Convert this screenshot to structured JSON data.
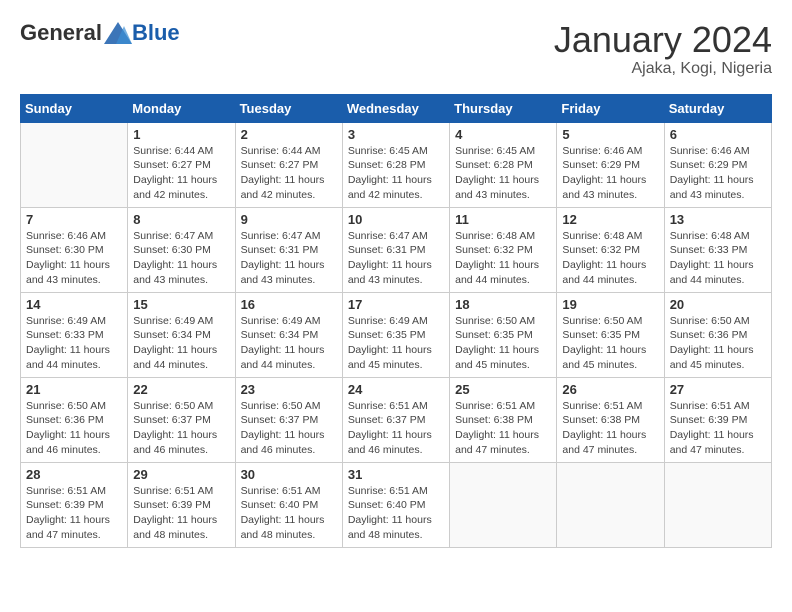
{
  "header": {
    "logo_general": "General",
    "logo_blue": "Blue",
    "month_title": "January 2024",
    "location": "Ajaka, Kogi, Nigeria"
  },
  "weekdays": [
    "Sunday",
    "Monday",
    "Tuesday",
    "Wednesday",
    "Thursday",
    "Friday",
    "Saturday"
  ],
  "weeks": [
    [
      {
        "day": "",
        "info": ""
      },
      {
        "day": "1",
        "info": "Sunrise: 6:44 AM\nSunset: 6:27 PM\nDaylight: 11 hours and 42 minutes."
      },
      {
        "day": "2",
        "info": "Sunrise: 6:44 AM\nSunset: 6:27 PM\nDaylight: 11 hours and 42 minutes."
      },
      {
        "day": "3",
        "info": "Sunrise: 6:45 AM\nSunset: 6:28 PM\nDaylight: 11 hours and 42 minutes."
      },
      {
        "day": "4",
        "info": "Sunrise: 6:45 AM\nSunset: 6:28 PM\nDaylight: 11 hours and 43 minutes."
      },
      {
        "day": "5",
        "info": "Sunrise: 6:46 AM\nSunset: 6:29 PM\nDaylight: 11 hours and 43 minutes."
      },
      {
        "day": "6",
        "info": "Sunrise: 6:46 AM\nSunset: 6:29 PM\nDaylight: 11 hours and 43 minutes."
      }
    ],
    [
      {
        "day": "7",
        "info": "Sunrise: 6:46 AM\nSunset: 6:30 PM\nDaylight: 11 hours and 43 minutes."
      },
      {
        "day": "8",
        "info": "Sunrise: 6:47 AM\nSunset: 6:30 PM\nDaylight: 11 hours and 43 minutes."
      },
      {
        "day": "9",
        "info": "Sunrise: 6:47 AM\nSunset: 6:31 PM\nDaylight: 11 hours and 43 minutes."
      },
      {
        "day": "10",
        "info": "Sunrise: 6:47 AM\nSunset: 6:31 PM\nDaylight: 11 hours and 43 minutes."
      },
      {
        "day": "11",
        "info": "Sunrise: 6:48 AM\nSunset: 6:32 PM\nDaylight: 11 hours and 44 minutes."
      },
      {
        "day": "12",
        "info": "Sunrise: 6:48 AM\nSunset: 6:32 PM\nDaylight: 11 hours and 44 minutes."
      },
      {
        "day": "13",
        "info": "Sunrise: 6:48 AM\nSunset: 6:33 PM\nDaylight: 11 hours and 44 minutes."
      }
    ],
    [
      {
        "day": "14",
        "info": "Sunrise: 6:49 AM\nSunset: 6:33 PM\nDaylight: 11 hours and 44 minutes."
      },
      {
        "day": "15",
        "info": "Sunrise: 6:49 AM\nSunset: 6:34 PM\nDaylight: 11 hours and 44 minutes."
      },
      {
        "day": "16",
        "info": "Sunrise: 6:49 AM\nSunset: 6:34 PM\nDaylight: 11 hours and 44 minutes."
      },
      {
        "day": "17",
        "info": "Sunrise: 6:49 AM\nSunset: 6:35 PM\nDaylight: 11 hours and 45 minutes."
      },
      {
        "day": "18",
        "info": "Sunrise: 6:50 AM\nSunset: 6:35 PM\nDaylight: 11 hours and 45 minutes."
      },
      {
        "day": "19",
        "info": "Sunrise: 6:50 AM\nSunset: 6:35 PM\nDaylight: 11 hours and 45 minutes."
      },
      {
        "day": "20",
        "info": "Sunrise: 6:50 AM\nSunset: 6:36 PM\nDaylight: 11 hours and 45 minutes."
      }
    ],
    [
      {
        "day": "21",
        "info": "Sunrise: 6:50 AM\nSunset: 6:36 PM\nDaylight: 11 hours and 46 minutes."
      },
      {
        "day": "22",
        "info": "Sunrise: 6:50 AM\nSunset: 6:37 PM\nDaylight: 11 hours and 46 minutes."
      },
      {
        "day": "23",
        "info": "Sunrise: 6:50 AM\nSunset: 6:37 PM\nDaylight: 11 hours and 46 minutes."
      },
      {
        "day": "24",
        "info": "Sunrise: 6:51 AM\nSunset: 6:37 PM\nDaylight: 11 hours and 46 minutes."
      },
      {
        "day": "25",
        "info": "Sunrise: 6:51 AM\nSunset: 6:38 PM\nDaylight: 11 hours and 47 minutes."
      },
      {
        "day": "26",
        "info": "Sunrise: 6:51 AM\nSunset: 6:38 PM\nDaylight: 11 hours and 47 minutes."
      },
      {
        "day": "27",
        "info": "Sunrise: 6:51 AM\nSunset: 6:39 PM\nDaylight: 11 hours and 47 minutes."
      }
    ],
    [
      {
        "day": "28",
        "info": "Sunrise: 6:51 AM\nSunset: 6:39 PM\nDaylight: 11 hours and 47 minutes."
      },
      {
        "day": "29",
        "info": "Sunrise: 6:51 AM\nSunset: 6:39 PM\nDaylight: 11 hours and 48 minutes."
      },
      {
        "day": "30",
        "info": "Sunrise: 6:51 AM\nSunset: 6:40 PM\nDaylight: 11 hours and 48 minutes."
      },
      {
        "day": "31",
        "info": "Sunrise: 6:51 AM\nSunset: 6:40 PM\nDaylight: 11 hours and 48 minutes."
      },
      {
        "day": "",
        "info": ""
      },
      {
        "day": "",
        "info": ""
      },
      {
        "day": "",
        "info": ""
      }
    ]
  ]
}
